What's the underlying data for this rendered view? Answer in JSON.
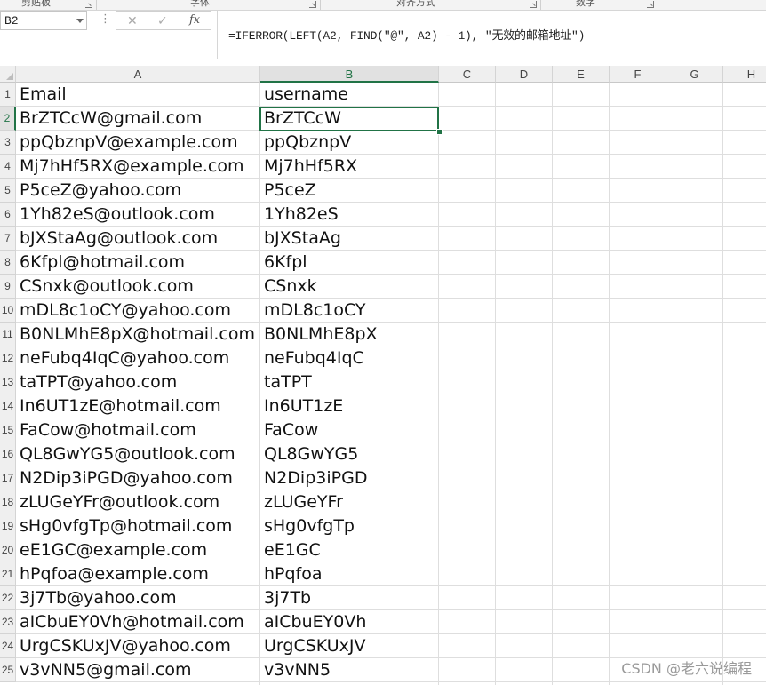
{
  "ribbon": {
    "groups": [
      {
        "label": "剪贴板"
      },
      {
        "label": "字体"
      },
      {
        "label": "对齐方式"
      },
      {
        "label": "数字"
      }
    ]
  },
  "formula_bar": {
    "name_box": "B2",
    "cancel_glyph": "✕",
    "enter_glyph": "✓",
    "fx_label": "fx",
    "formula": "=IFERROR(LEFT(A2, FIND(\"@\", A2) - 1), \"无效的邮箱地址\")"
  },
  "sheet": {
    "columns": [
      "A",
      "B",
      "C",
      "D",
      "E",
      "F",
      "G",
      "H"
    ],
    "selected_column": "B",
    "selected_cell": "B2",
    "rows": [
      {
        "n": "1",
        "a": "Email",
        "b": "username"
      },
      {
        "n": "2",
        "a": "BrZTCcW@gmail.com",
        "b": "BrZTCcW"
      },
      {
        "n": "3",
        "a": "ppQbznpV@example.com",
        "b": "ppQbznpV"
      },
      {
        "n": "4",
        "a": "Mj7hHf5RX@example.com",
        "b": "Mj7hHf5RX"
      },
      {
        "n": "5",
        "a": "P5ceZ@yahoo.com",
        "b": "P5ceZ"
      },
      {
        "n": "6",
        "a": "1Yh82eS@outlook.com",
        "b": "1Yh82eS"
      },
      {
        "n": "7",
        "a": "bJXStaAg@outlook.com",
        "b": "bJXStaAg"
      },
      {
        "n": "8",
        "a": "6Kfpl@hotmail.com",
        "b": "6Kfpl"
      },
      {
        "n": "9",
        "a": "CSnxk@outlook.com",
        "b": "CSnxk"
      },
      {
        "n": "10",
        "a": "mDL8c1oCY@yahoo.com",
        "b": "mDL8c1oCY"
      },
      {
        "n": "11",
        "a": "B0NLMhE8pX@hotmail.com",
        "b": "B0NLMhE8pX"
      },
      {
        "n": "12",
        "a": "neFubq4IqC@yahoo.com",
        "b": "neFubq4IqC"
      },
      {
        "n": "13",
        "a": "taTPT@yahoo.com",
        "b": "taTPT"
      },
      {
        "n": "14",
        "a": "In6UT1zE@hotmail.com",
        "b": "In6UT1zE"
      },
      {
        "n": "15",
        "a": "FaCow@hotmail.com",
        "b": "FaCow"
      },
      {
        "n": "16",
        "a": "QL8GwYG5@outlook.com",
        "b": "QL8GwYG5"
      },
      {
        "n": "17",
        "a": "N2Dip3iPGD@yahoo.com",
        "b": "N2Dip3iPGD"
      },
      {
        "n": "18",
        "a": "zLUGeYFr@outlook.com",
        "b": "zLUGeYFr"
      },
      {
        "n": "19",
        "a": "sHg0vfgTp@hotmail.com",
        "b": "sHg0vfgTp"
      },
      {
        "n": "20",
        "a": "eE1GC@example.com",
        "b": "eE1GC"
      },
      {
        "n": "21",
        "a": "hPqfoa@example.com",
        "b": "hPqfoa"
      },
      {
        "n": "22",
        "a": "3j7Tb@yahoo.com",
        "b": "3j7Tb"
      },
      {
        "n": "23",
        "a": "aICbuEY0Vh@hotmail.com",
        "b": "aICbuEY0Vh"
      },
      {
        "n": "24",
        "a": "UrgCSKUxJV@yahoo.com",
        "b": "UrgCSKUxJV"
      },
      {
        "n": "25",
        "a": "v3vNN5@gmail.com",
        "b": "v3vNN5"
      }
    ]
  },
  "watermark": "CSDN @老六说编程",
  "colors": {
    "accent": "#217346",
    "header_bg": "#efefef",
    "gridline": "#dedede"
  }
}
